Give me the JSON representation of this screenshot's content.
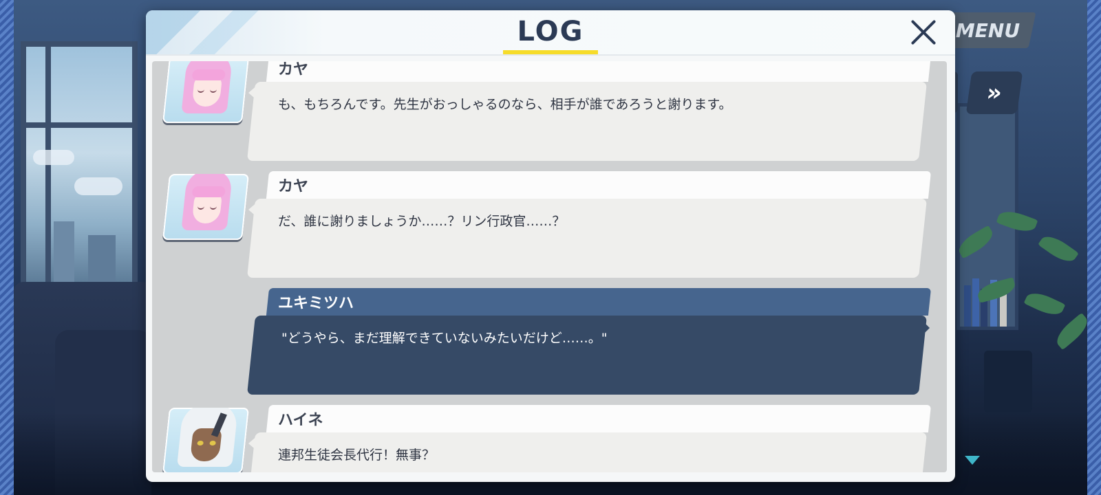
{
  "log": {
    "title": "LOG",
    "close_icon": "close-icon",
    "entries": [
      {
        "speaker": "カヤ",
        "text": "も、もちろんです。先生がおっしゃるのなら、相手が誰であろうと謝ります。",
        "avatar": "kaya-portrait"
      },
      {
        "speaker": "カヤ",
        "text": "だ、誰に謝りましょうか……？リン行政官……？",
        "avatar": "kaya-portrait"
      },
      {
        "speaker": "ユキミツハ",
        "text": "\"どうやら、まだ理解できていないみたいだけど……。\"",
        "avatar": ""
      },
      {
        "speaker": "ハイネ",
        "text": "連邦生徒会長代行！無事？",
        "avatar": "haine-portrait"
      }
    ]
  },
  "hud": {
    "menu_label": "MENU",
    "skip_icon": "fast-forward-icon",
    "skip_glyph": "»",
    "scroll_icon": "triangle-down-icon"
  },
  "colors": {
    "accent_underline": "#f6dc2a",
    "player_name_bar": "#46658e",
    "player_bubble": "#364a66",
    "npc_bubble": "#efefed",
    "title_text": "#2b3a55"
  }
}
